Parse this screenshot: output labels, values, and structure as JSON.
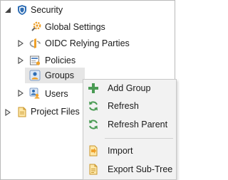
{
  "tree": {
    "security": {
      "label": "Security",
      "icon": "shield-icon",
      "expanded": true
    },
    "global_settings": {
      "label": "Global Settings",
      "icon": "gear-icon"
    },
    "oidc": {
      "label": "OIDC Relying Parties",
      "icon": "openid-icon"
    },
    "policies": {
      "label": "Policies",
      "icon": "policy-icon"
    },
    "groups": {
      "label": "Groups",
      "icon": "group-icon",
      "selected": true
    },
    "users": {
      "label": "Users",
      "icon": "users-icon"
    },
    "project_files": {
      "label": "Project Files",
      "icon": "project-files-icon"
    }
  },
  "context_menu": {
    "items": [
      {
        "label": "Add Group",
        "icon": "plus-icon"
      },
      {
        "label": "Refresh",
        "icon": "refresh-icon"
      },
      {
        "label": "Refresh Parent",
        "icon": "refresh-parent-icon"
      },
      {
        "label": "Import",
        "icon": "import-icon"
      },
      {
        "label": "Export Sub-Tree",
        "icon": "export-icon"
      }
    ]
  },
  "colors": {
    "selection": "#e6e6e6",
    "menu_bg": "#f2f2f2",
    "green": "#4a9b54",
    "shield": "#2e6db4",
    "orange": "#f0a12a"
  }
}
